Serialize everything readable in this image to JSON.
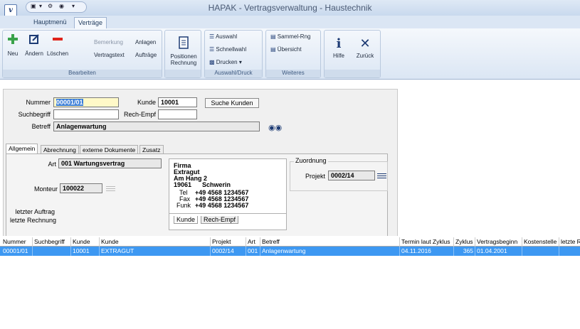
{
  "window": {
    "title": "HAPAK - Vertragsverwaltung - Haustechnik",
    "logo": "v"
  },
  "ribbon_tabs": [
    "Hauptmenü",
    "Verträge"
  ],
  "groups": {
    "bearbeiten": {
      "label": "Bearbeiten",
      "neu": "Neu",
      "aendern": "Ändern",
      "loeschen": "Löschen",
      "bemerkung": "Bemerkung",
      "vertragstext": "Vertragstext",
      "anlagen": "Anlagen",
      "auftraege": "Aufträge"
    },
    "positionen": {
      "line1": "Positionen",
      "line2": "Rechnung"
    },
    "auswahl": {
      "label": "Auswahl/Druck",
      "auswahl": "Auswahl",
      "schnellwahl": "Schnellwahl",
      "drucken": "Drucken"
    },
    "weiteres": {
      "label": "Weiteres",
      "sammel": "Sammel-Rng",
      "uebersicht": "Übersicht"
    },
    "hilfe": "Hilfe",
    "zurueck": "Zurück"
  },
  "form": {
    "nummer_label": "Nummer",
    "nummer": "00001/01",
    "kunde_label": "Kunde",
    "kunde": "10001",
    "suche_kunden": "Suche Kunden",
    "suchbegriff_label": "Suchbegriff",
    "suchbegriff": "",
    "rechempf_label": "Rech-Empf",
    "rechempf": "",
    "betreff_label": "Betreff",
    "betreff": "Anlagenwartung"
  },
  "form_tabs": [
    "Allgemein",
    "Abrechnung",
    "externe Dokumente",
    "Zusatz"
  ],
  "allgemein": {
    "art_label": "Art",
    "art": "001 Wartungsvertrag",
    "monteur_label": "Monteur",
    "monteur": "100022",
    "letzter_auftrag": "letzter Auftrag",
    "letzte_rechnung": "letzte Rechnung",
    "zuordnung": "Zuordnung",
    "projekt_label": "Projekt",
    "projekt": "0002/14"
  },
  "card": {
    "firma": "Firma",
    "name": "Extragut",
    "strasse": "Am Hang 2",
    "plz": "19061",
    "ort": "Schwerin",
    "tel_label": "Tel",
    "tel": "+49 4568 1234567",
    "fax_label": "Fax",
    "fax": "+49 4568 1234567",
    "funk_label": "Funk",
    "funk": "+49 4568 1234567",
    "tab_kunde": "Kunde",
    "tab_rechempf": "Rech-Empf"
  },
  "table": {
    "headers": [
      "Nummer",
      "Suchbegriff",
      "Kunde",
      "Kunde",
      "Projekt",
      "Art",
      "Betreff",
      "Termin laut Zyklus",
      "Zyklus",
      "Vertragsbeginn",
      "Kostenstelle",
      "letzte R"
    ],
    "rows": [
      [
        "00001/01",
        "",
        "10001",
        "EXTRAGUT",
        "0002/14",
        "001",
        "Anlagenwartung",
        "04.11.2016",
        "365",
        "01.04.2001",
        "",
        ""
      ]
    ]
  },
  "colors": {
    "selection": "#3d98f2",
    "highlight_field": "#fff9c8",
    "ribbon": "#dbe6f4"
  }
}
